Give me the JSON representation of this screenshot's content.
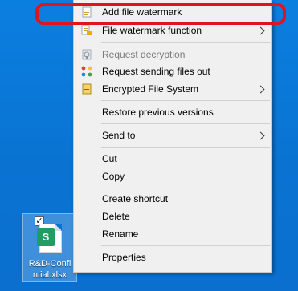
{
  "desktop": {
    "file": {
      "label": "R&D-Confidential.xlsx",
      "label_display": "R&D-Confi\nntial.xlsx",
      "badge": "S",
      "selected": true
    }
  },
  "context_menu": {
    "items": [
      {
        "label": "Add file watermark",
        "icon": "watermark-doc-icon"
      },
      {
        "label": "File watermark function",
        "icon": "watermark-settings-icon",
        "submenu": true
      },
      {
        "label": "Request decryption",
        "icon": "request-decryption-icon",
        "disabled": true
      },
      {
        "label": "Request sending files out",
        "icon": "send-files-icon"
      },
      {
        "label": "Encrypted File System",
        "icon": "encrypted-fs-icon",
        "submenu": true
      },
      {
        "label": "Restore previous versions"
      },
      {
        "label": "Send to",
        "submenu": true
      },
      {
        "label": "Cut"
      },
      {
        "label": "Copy"
      },
      {
        "label": "Create shortcut"
      },
      {
        "label": "Delete"
      },
      {
        "label": "Rename"
      },
      {
        "label": "Properties"
      }
    ]
  },
  "colors": {
    "desktop_bg": "#0a78d8",
    "menu_bg": "#f0f0f0",
    "highlight_outline": "#e0141e",
    "sheet_badge": "#1f9d62"
  }
}
